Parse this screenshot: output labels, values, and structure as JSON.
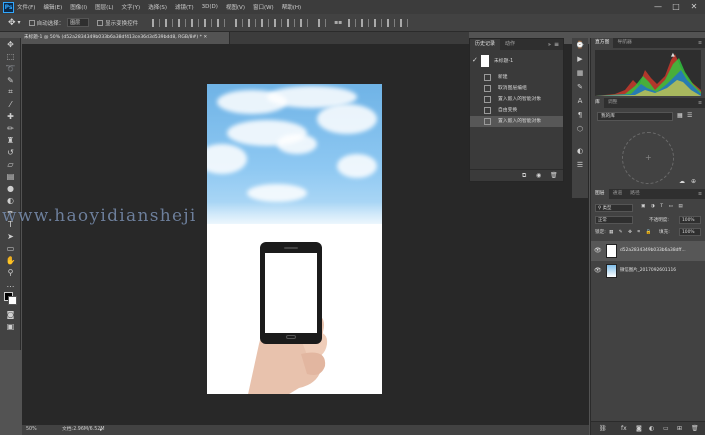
{
  "app": {
    "logo": "Ps"
  },
  "menu": [
    "文件(F)",
    "编辑(E)",
    "图像(I)",
    "图层(L)",
    "文字(Y)",
    "选择(S)",
    "滤镜(T)",
    "3D(D)",
    "视图(V)",
    "窗口(W)",
    "帮助(H)"
  ],
  "window_controls": {
    "minimize": "—",
    "maximize": "□",
    "close": "✕"
  },
  "options_bar": {
    "auto_select_label": "自动选择：",
    "auto_select_value": "图层",
    "transform_label": "显示变换控件"
  },
  "document": {
    "tab_title": "未标题-1 @ 50% (d52a2834349b033b6a38df413ce36d3d539bdd8, RGB/8#) *"
  },
  "watermark": "www.haoyidiansheji",
  "status": {
    "zoom": "50%",
    "doc_info": "文档:2.96M/6.52M"
  },
  "history": {
    "tabs": [
      "历史记录",
      "动作"
    ],
    "snapshot_label": "未标题-1",
    "items": [
      "新建",
      "取消图层编组",
      "置入嵌入的智能对象",
      "自由变换",
      "置入嵌入的智能对象"
    ]
  },
  "right": {
    "histogram_tabs": [
      "直方图",
      "导航器"
    ],
    "library_tabs": [
      "库",
      "调整"
    ],
    "library_select": "我的库",
    "layers_tabs": [
      "图层",
      "通道",
      "路径"
    ],
    "filter_label": "类型",
    "blend_mode": "正常",
    "opacity_label": "不透明度:",
    "opacity_value": "100%",
    "lock_label": "锁定:",
    "fill_label": "填充:",
    "fill_value": "100%",
    "layers": [
      {
        "name": "d52a2834349b033b6a38dff..."
      },
      {
        "name": "微信图片_2017092601116"
      }
    ]
  },
  "colors": {
    "accent": "#31a8ff",
    "canvas_bg": "#282828",
    "panel_bg": "#424242"
  }
}
